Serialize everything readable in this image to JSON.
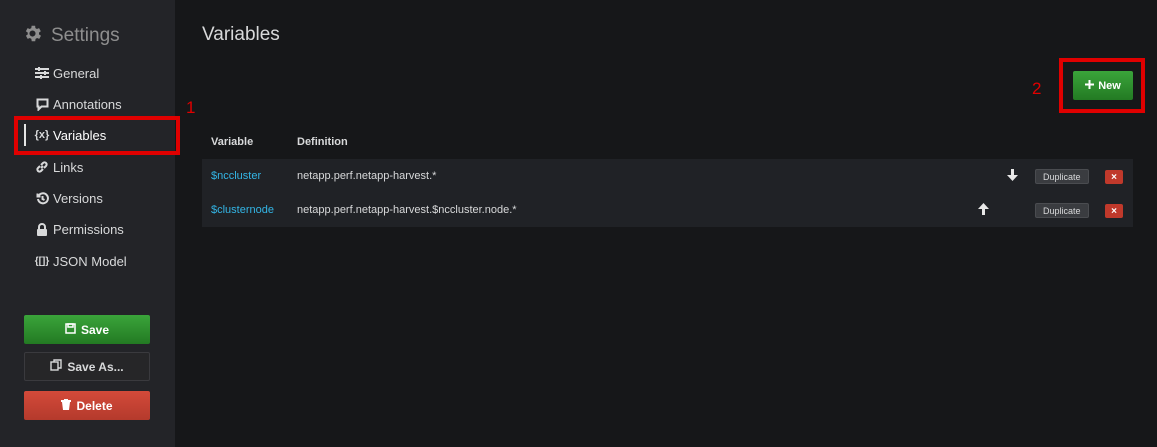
{
  "sidebar": {
    "title": "Settings",
    "items": [
      {
        "label": "General",
        "icon": "sliders-icon"
      },
      {
        "label": "Annotations",
        "icon": "comment-icon"
      },
      {
        "label": "Variables",
        "icon": "variable-icon",
        "icon_text": "{x}"
      },
      {
        "label": "Links",
        "icon": "link-icon"
      },
      {
        "label": "Versions",
        "icon": "history-icon"
      },
      {
        "label": "Permissions",
        "icon": "lock-icon"
      },
      {
        "label": "JSON Model",
        "icon": "json-icon",
        "icon_text": "{[]}"
      }
    ],
    "save_label": "Save",
    "save_as_label": "Save As...",
    "delete_label": "Delete"
  },
  "main": {
    "title": "Variables",
    "new_button_label": "New",
    "columns": [
      "Variable",
      "Definition"
    ],
    "rows": [
      {
        "variable": "$nccluster",
        "definition": "netapp.perf.netapp-harvest.*",
        "arrow": "down",
        "duplicate_label": "Duplicate",
        "delete_label": "×"
      },
      {
        "variable": "$clusternode",
        "definition": "netapp.perf.netapp-harvest.$nccluster.node.*",
        "arrow": "up",
        "duplicate_label": "Duplicate",
        "delete_label": "×"
      }
    ]
  },
  "annotations": {
    "label_1": "1",
    "label_2": "2",
    "color": "#e00000"
  },
  "colors": {
    "accent_link": "#33b5e5",
    "save_green": "#299c29",
    "delete_red": "#c0392b"
  }
}
